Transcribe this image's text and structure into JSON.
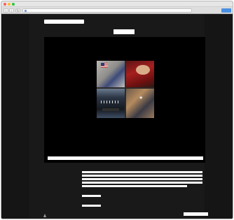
{
  "browser": {
    "window_title": "",
    "url": "",
    "back_glyph": "‹",
    "forward_glyph": "›",
    "reload_glyph": "↻",
    "action_label": ""
  },
  "site": {
    "nav_links": [
      "",
      ""
    ]
  },
  "details": {
    "labels": [
      "",
      "",
      ""
    ]
  },
  "footer": {
    "brand_text": ""
  },
  "colors": {
    "page_background": "#191919",
    "stage_background": "#000000",
    "text_placeholder": "#ffffff",
    "action_button": "#4a90e2"
  }
}
